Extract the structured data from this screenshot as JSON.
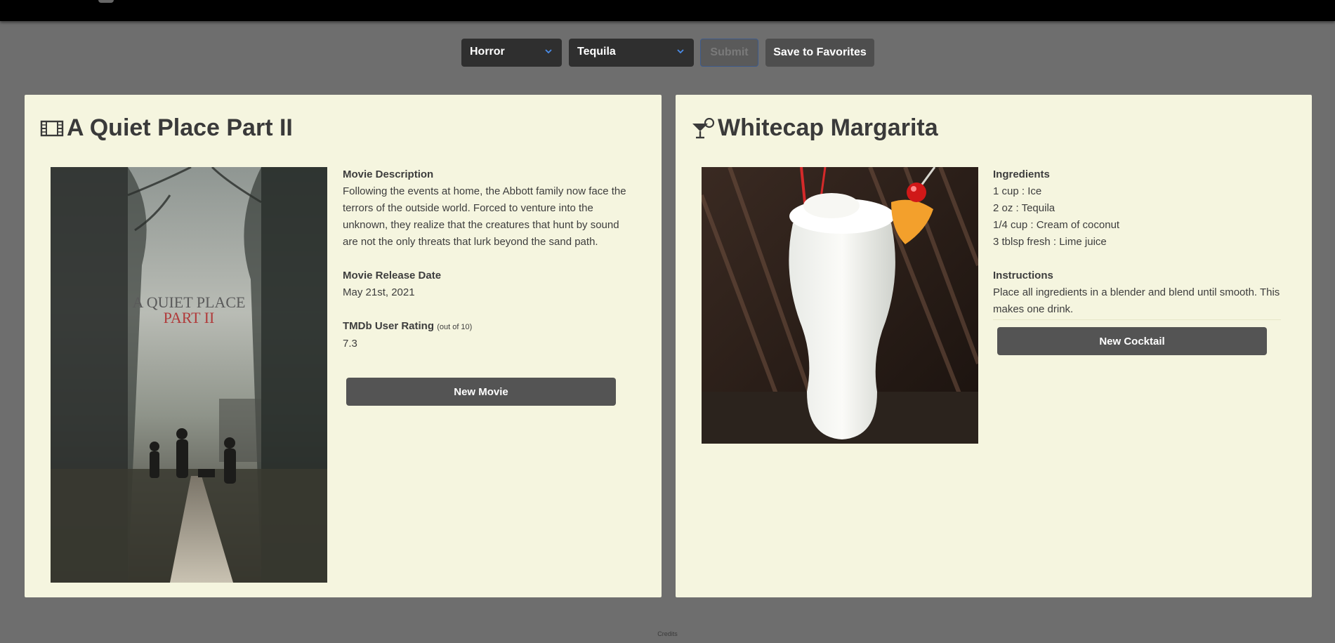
{
  "filters": {
    "genre": "Horror",
    "spirit": "Tequila",
    "submit_label": "Submit",
    "save_label": "Save to Favorites"
  },
  "movie": {
    "icon": "film-icon",
    "title": "A Quiet Place Part II",
    "poster_title_line1": "A QUIET PLACE",
    "poster_title_line2": "PART II",
    "description_label": "Movie Description",
    "description": "Following the events at home, the Abbott family now face the terrors of the outside world. Forced to venture into the unknown, they realize that the creatures that hunt by sound are not the only threats that lurk beyond the sand path.",
    "release_label": "Movie Release Date",
    "release_date": "May 21st, 2021",
    "rating_label": "TMDb User Rating",
    "rating_note": "(out of 10)",
    "rating": "7.3",
    "new_button": "New Movie"
  },
  "cocktail": {
    "icon": "cocktail-icon",
    "title": "Whitecap Margarita",
    "ingredients_label": "Ingredients",
    "ingredients": [
      "1 cup : Ice",
      "2 oz : Tequila",
      "1/4 cup : Cream of coconut",
      "3 tblsp fresh : Lime juice"
    ],
    "instructions_label": "Instructions",
    "instructions": "Place all ingredients in a blender and blend until smooth. This makes one drink.",
    "new_button": "New Cocktail"
  },
  "footer": {
    "credits": "Credits"
  }
}
